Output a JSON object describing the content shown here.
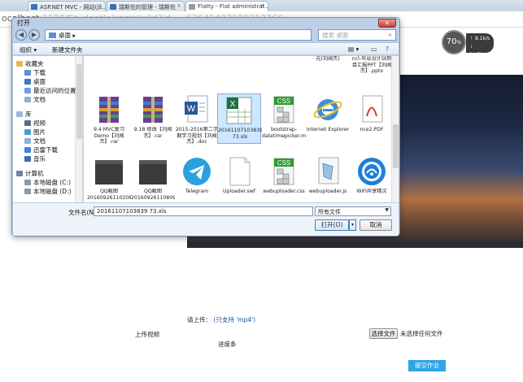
{
  "browser": {
    "tabs": [
      {
        "label": "ASP.NET MVC - 网站(js..."
      },
      {
        "label": "瑞斯佐的管理 - 瑞斯佐"
      },
      {
        "label": "Flatty - Flat administrat..."
      }
    ],
    "url_visible": "ocalhost",
    "url_faded": ":1129/StudentJs/sample/id?id=...636454071082137C6"
  },
  "page": {
    "gauge_value": "70",
    "gauge_unit": "%",
    "speed_up": "8.1k/s",
    "speed_down": "14.7k/s",
    "upload_prompt": "请上传：",
    "upload_hint": "(只支持 'mp4')",
    "upload_label": "上传视频",
    "progress_label": "进度条",
    "choose_file": "选择文件",
    "no_file": "未选择任何文件",
    "submit": "提交作业"
  },
  "dialog": {
    "title": "打开",
    "close": "✕",
    "breadcrumb": "桌面",
    "search_placeholder": "搜索 桌面",
    "organize": "组织 ▾",
    "new_folder": "新建文件夹",
    "tree": [
      {
        "label": "收藏夹",
        "level": 0,
        "color": "#e8b84a"
      },
      {
        "label": "下载",
        "level": 1,
        "color": "#5b8fcf"
      },
      {
        "label": "桌面",
        "level": 1,
        "color": "#3f78c2"
      },
      {
        "label": "最近访问的位置",
        "level": 1,
        "color": "#6f9fd6"
      },
      {
        "label": "文档",
        "level": 1,
        "color": "#8fb2da"
      },
      {
        "label": "库",
        "level": 0,
        "color": "#9bb7d8"
      },
      {
        "label": "视频",
        "level": 1,
        "color": "#5a6e8c"
      },
      {
        "label": "图片",
        "level": 1,
        "color": "#4e9bd1"
      },
      {
        "label": "文档",
        "level": 1,
        "color": "#8fb2da"
      },
      {
        "label": "迅雷下载",
        "level": 1,
        "color": "#3f83d4"
      },
      {
        "label": "音乐",
        "level": 1,
        "color": "#3f6fb0"
      },
      {
        "label": "计算机",
        "level": 0,
        "color": "#6b86a6"
      },
      {
        "label": "本地磁盘 (C:)",
        "level": 1,
        "color": "#8c9aab"
      },
      {
        "label": "本地磁盘 (D:)",
        "level": 1,
        "color": "#8c9aab"
      }
    ],
    "files_partial_top": [
      {
        "label": "元(刘闻杰)",
        "col": 5
      },
      {
        "label": "ncl-毕业设计站项目汇报PPT【刘闻杰】.pptx",
        "col": 6
      }
    ],
    "files": [
      {
        "label": "9.4 MVC复习 Demo【刘闻杰】.rar",
        "icon": "rar",
        "row": 0,
        "col": 0
      },
      {
        "label": "9.18 修改【刘闻杰】.rar",
        "icon": "rar",
        "row": 0,
        "col": 1
      },
      {
        "label": "2015-2016第二学期学习规划【刘闻杰】.doc",
        "icon": "word",
        "row": 0,
        "col": 2
      },
      {
        "label": "20161107103839 73.xls",
        "icon": "excel",
        "row": 0,
        "col": 3,
        "selected": true
      },
      {
        "label": "bootstrap-datetimepicker.min.css",
        "icon": "css",
        "row": 0,
        "col": 4
      },
      {
        "label": "Internet Explorer",
        "icon": "ie",
        "row": 0,
        "col": 5
      },
      {
        "label": "nce2.PDF",
        "icon": "pdf",
        "row": 0,
        "col": 6
      },
      {
        "label": "QQ截图20160926110208.png",
        "icon": "dark",
        "row": 1,
        "col": 0
      },
      {
        "label": "QQ截图20160926110809.png",
        "icon": "dark",
        "row": 1,
        "col": 1
      },
      {
        "label": "Telegram",
        "icon": "telegram",
        "row": 1,
        "col": 2
      },
      {
        "label": "Uploader.swf",
        "icon": "blank",
        "row": 1,
        "col": 3
      },
      {
        "label": "webuploader.css",
        "icon": "css",
        "row": 1,
        "col": 4
      },
      {
        "label": "webuploader.js",
        "icon": "js",
        "row": 1,
        "col": 5
      },
      {
        "label": "WiFi共享精灵",
        "icon": "wifi",
        "row": 1,
        "col": 6
      }
    ],
    "filename_label": "文件名(N):",
    "filename_value": "20161107103839 73.xls",
    "filetype_value": "所有文件",
    "open": "打开(O)",
    "cancel": "取消"
  }
}
